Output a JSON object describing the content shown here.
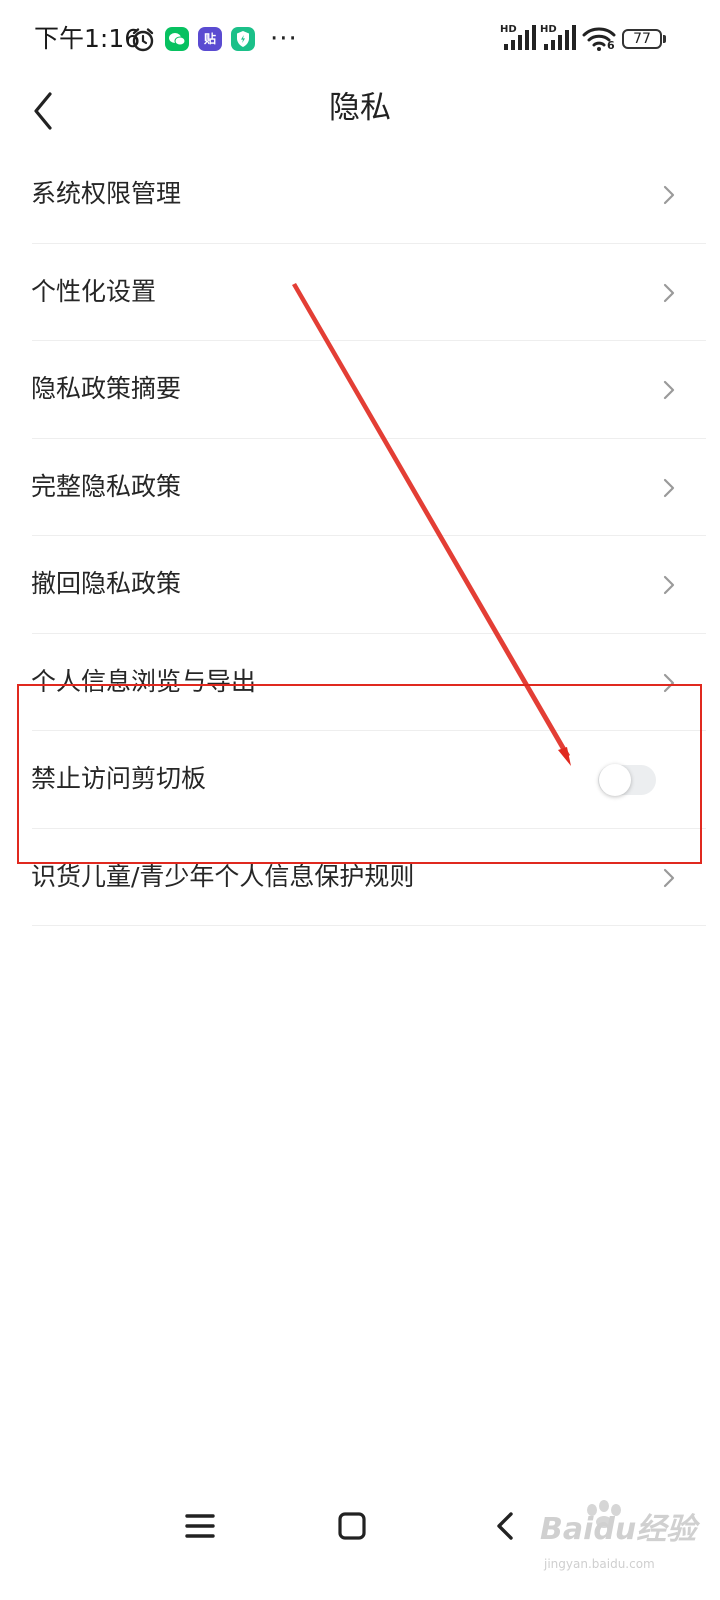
{
  "status_bar": {
    "time": "下午1:16",
    "battery": "77",
    "network_badge": "HD",
    "wifi_sub": "6",
    "app_badge_text": "贴",
    "more_dots": "···"
  },
  "header": {
    "title": "隐私"
  },
  "settings": {
    "items": [
      {
        "label": "系统权限管理",
        "control": "chevron"
      },
      {
        "label": "个性化设置",
        "control": "chevron"
      },
      {
        "label": "隐私政策摘要",
        "control": "chevron"
      },
      {
        "label": "完整隐私政策",
        "control": "chevron"
      },
      {
        "label": "撤回隐私政策",
        "control": "chevron"
      },
      {
        "label": "个人信息浏览与导出",
        "control": "chevron"
      },
      {
        "label": "禁止访问剪切板",
        "control": "toggle",
        "enabled": false
      },
      {
        "label": "识货儿童/青少年个人信息保护规则",
        "control": "chevron"
      }
    ]
  },
  "watermark": {
    "brand": "Baidu经验",
    "url": "jingyan.baidu.com"
  },
  "colors": {
    "annotation_red": "#e0291f",
    "divider": "#eeeeee",
    "chevron": "#9a9a9a",
    "toggle_track_off": "#eceef0",
    "wechat_green": "#07c160",
    "tieba_purple": "#5a4bd1",
    "shield_teal": "#1bc089"
  },
  "icons": {
    "back": "chevron-left-icon",
    "row_arrow": "chevron-right-icon",
    "alarm": "alarm-clock-icon",
    "wechat": "wechat-icon",
    "tieba": "tieba-icon",
    "security": "shield-icon",
    "signal": "signal-icon",
    "wifi": "wifi-icon",
    "nav_menu": "menu-icon",
    "nav_home": "home-icon",
    "nav_back": "back-icon"
  }
}
